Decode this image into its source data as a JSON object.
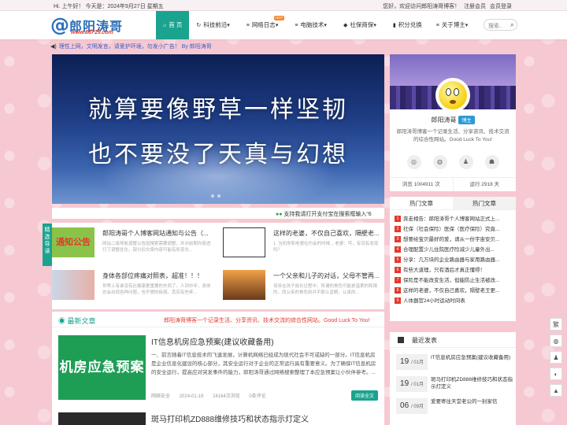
{
  "topbar": {
    "greeting": "Hi. 上午好！ 今天是：2024年9月27日 星期五",
    "welcome": "您好，欢迎访问郎阳涛哥博客！",
    "register": "注册会员",
    "login": "会员登录"
  },
  "logo": {
    "name": "郎阳涛哥",
    "url": "www.86719.com"
  },
  "nav": {
    "items": [
      {
        "label": "首 页",
        "icon": "home-icon"
      },
      {
        "label": "科技前沿",
        "icon": "sync-icon"
      },
      {
        "label": "网络日志",
        "icon": "list-icon",
        "badge": "HOT"
      },
      {
        "label": "电脑技术",
        "icon": "list-icon"
      },
      {
        "label": "社保商保",
        "icon": "diamond-icon"
      },
      {
        "label": "积分兑换",
        "icon": "bookmark-icon"
      },
      {
        "label": "关于博主",
        "icon": "list-icon"
      }
    ],
    "search_placeholder": "搜索.."
  },
  "notice": "理性上网，文明发言，请爱护环境，勿发小广告！ By 郎阳涛哥",
  "banner": {
    "line1": "就算要像野草一样坚韧",
    "line2": "也不要没了天真与幻想"
  },
  "ticker": "支持我请打开支付宝在搜索框输入“6",
  "cards": [
    {
      "title": "郎阳涛哥个人博客网站通知与公告（...",
      "desc": "网站二级导航调整公告因搜索需要调整，并对前期内容进行了调整优化，部分旧文章内容可能有所变化...",
      "thumb_text": "通知公告"
    },
    {
      "title": "这样的老婆，不仅自己喜欢，隔壁老...",
      "desc": "1. 当初你和老婆在约会的时候... 老婆：哼，有没有发现吗？"
    },
    {
      "title": "身体各部位疼痛对照表，超准！！！",
      "desc": "世界上有谁没有比健康更重要的东西了。人到中年，身体总会出现各种问题，也不想的疾病。其实有些疼..."
    },
    {
      "title": "一个父亲和儿子的对话，父母不管再...",
      "desc": "母亲在孩子成长过程中，所谓的角色可能是温柔的和蔼的，而父亲的角色则并不那么显眼，认真的..."
    }
  ],
  "side_tab": "精选导读",
  "latest": {
    "title": "最新文章",
    "slogan": "郎阳涛哥博客一个记录生活、分享资讯、技术交流的综合性网站。Good Luck To You!",
    "posts": [
      {
        "img_text": "机房应急预案",
        "title": "IT信息机房应急预案(建议收藏备用)",
        "desc": "一、前言随着IT信息技术的飞速发展，计算机网络已经成为现代社会不可或缺的一部分。IT信息机房是企业信息化建设的核心部分，其安全运行对于企业的正常运行具有重要意义。为了确保IT信息机房的安全运行，提高应对突发事件的能力，郎阳涛哥通过网络搜索整理了本应急预案让小伙伴参考。...",
        "category": "网络安全",
        "date": "2024-01-19",
        "views": "24164次浏览",
        "comments": "0条评论",
        "read": "阅读全文"
      },
      {
        "title": "斑马打印机ZD888维修技巧和状态指示灯定义"
      }
    ]
  },
  "profile": {
    "name": "郎阳涛哥",
    "badge": "博主",
    "desc": "郎阳涛哥博客一个记录生活、分享资讯、技术交流的综合性网站。Good Luck To You!",
    "views": "浏览 1004911 次",
    "uptime": "运行 2918 天"
  },
  "tabs": {
    "hot": "热门文章",
    "hot_list": [
      "奔走相告：郎阳涛哥个人博客网站正式上...",
      "社保（社会保险）医保（医疗保险）究竟...",
      "想要给宝贝最好的爱，请从一份宇宙安贝...",
      "合理配置少儿住院医疗险减少儿童外出...",
      "分享：几万块的企业路由器与家用路由器...",
      "有些大道理，只有酒后才真正懂得！",
      "保险是不能改变生活，但能防止生活被改...",
      "这样的老婆，不仅自己喜欢，隔壁老王更...",
      "人体器官24小时运动时间表"
    ],
    "related": "热门文章"
  },
  "recent": {
    "title": "最近发表",
    "items": [
      {
        "day": "19",
        "month": "01月",
        "title": "IT信息机房应急预案(建议收藏备用)"
      },
      {
        "day": "19",
        "month": "01月",
        "title": "斑马打印机ZD888维修技巧和状态指示灯定义"
      },
      {
        "day": "06",
        "month": "09月",
        "title": "爱要寄往天堂老公的一封家信"
      }
    ]
  },
  "float": [
    "繁",
    "微",
    "QQ",
    "顶"
  ],
  "colors": {
    "accent": "#1aa38e",
    "link": "#3a5cc9",
    "alert": "#e4392b"
  }
}
